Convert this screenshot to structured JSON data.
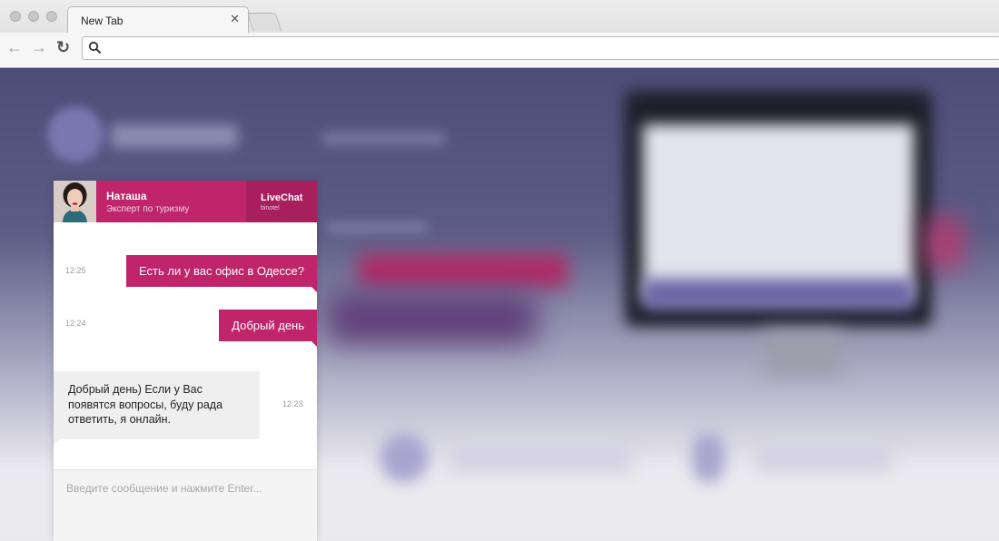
{
  "browser": {
    "tab_title": "New Tab",
    "tab_close_glyph": "✕",
    "back_glyph": "←",
    "forward_glyph": "→",
    "reload_glyph": "↻",
    "address_value": ""
  },
  "chat": {
    "agent_name": "Наташа",
    "agent_role": "Эксперт по туризму",
    "brand_name": "LiveChat",
    "brand_sub": "binotel",
    "messages": [
      {
        "direction": "out",
        "text": "Есть ли у вас офис в Одессе?",
        "time": "12:25"
      },
      {
        "direction": "out",
        "text": "Добрый день",
        "time": "12:24"
      },
      {
        "direction": "in",
        "text": "Добрый день) Если у Вас появятся вопросы, буду рада ответить, я онлайн.",
        "time": "12:23"
      }
    ],
    "input_placeholder": "Введите сообщение и нажмите Enter..."
  },
  "colors": {
    "accent": "#c0246b",
    "accent_dark": "#a81f5e",
    "incoming_bubble": "#efefef"
  }
}
